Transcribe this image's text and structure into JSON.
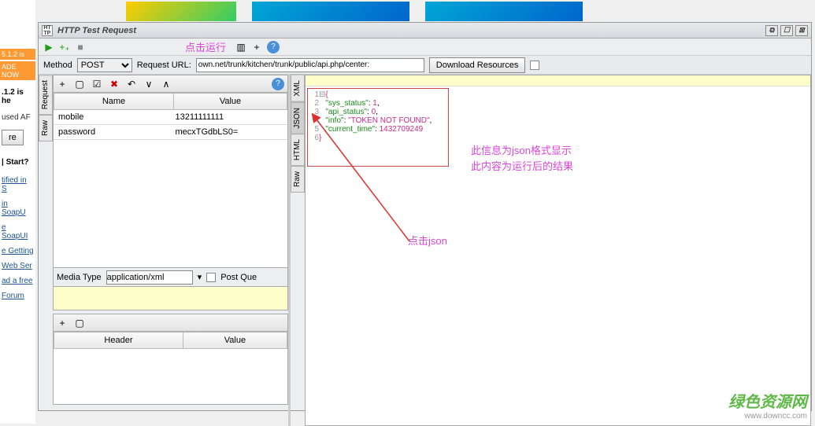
{
  "sidebar": {
    "badge": "5.1.2 is",
    "badge2": "ADE NOW",
    "heading": ".1.2 is he",
    "text1": "used AF",
    "btn": "re",
    "heading2": "| Start?",
    "links": [
      "tified in S",
      "in SoapU",
      "e SoapUI",
      "e Getting",
      "Web Ser",
      "ad a free",
      "Forum"
    ]
  },
  "window": {
    "title": "HTTP Test Request",
    "icon_label": "HT\nTP"
  },
  "toolbar": {
    "annot_run": "点击运行",
    "method_label": "Method",
    "method_value": "POST",
    "url_label": "Request URL:",
    "url_value": "own.net/trunk/kitchen/trunk/public/api.php/center:",
    "download_label": "Download Resources"
  },
  "left_tabs": [
    "Request",
    "Raw"
  ],
  "params": {
    "tb_icons": [
      "+",
      "▢",
      "☑",
      "✖",
      "↶",
      "∨",
      "∧"
    ],
    "headers": [
      "Name",
      "Value"
    ],
    "rows": [
      {
        "name": "mobile",
        "value": "13211111111"
      },
      {
        "name": "password",
        "value": "mecxTGdbLS0="
      }
    ]
  },
  "media": {
    "label": "Media Type",
    "value": "application/xml",
    "post_label": "Post Que"
  },
  "headers_panel": {
    "tb_icons": [
      "+",
      "▢"
    ],
    "headers": [
      "Header",
      "Value"
    ]
  },
  "right_tabs": [
    "XML",
    "JSON",
    "HTML",
    "Raw"
  ],
  "response": {
    "lines": [
      {
        "n": "1",
        "text": "{"
      },
      {
        "n": "2",
        "text": "   \"sys_status\": 1,"
      },
      {
        "n": "3",
        "text": "   \"api_status\": 0,"
      },
      {
        "n": "4",
        "text": "   \"info\": \"TOKEN NOT FOUND\","
      },
      {
        "n": "5",
        "text": "   \"current_time\": 1432709249"
      },
      {
        "n": "6",
        "text": "}"
      }
    ]
  },
  "annotations": {
    "a1": "此信息为json格式显示",
    "a2": "此内容为运行后的结果",
    "a3": "点击json"
  },
  "watermark": {
    "cn": "绿色资源网",
    "url": "www.downcc.com"
  }
}
